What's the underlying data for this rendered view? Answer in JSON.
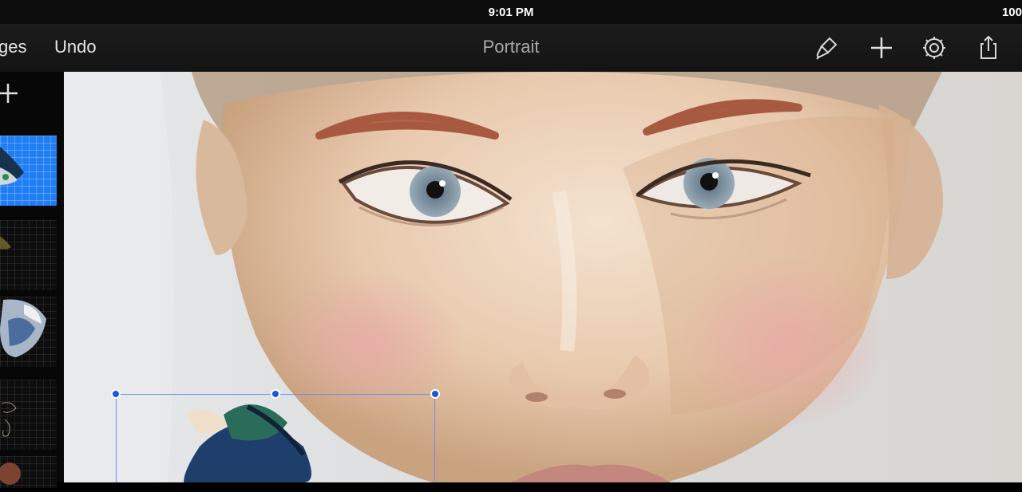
{
  "status": {
    "time": "9:01 PM",
    "battery": "100",
    "lead": ""
  },
  "toolbar": {
    "gallery_label": "ges",
    "undo_label": "Undo",
    "title": "Portrait",
    "icons": [
      "brush-icon",
      "plus-icon",
      "gear-icon",
      "share-icon"
    ]
  },
  "sidebar": {
    "add_icon": "plus-icon",
    "layers": [
      {
        "name": "bird-layer",
        "active": true
      },
      {
        "name": "leaf-layer",
        "active": false
      },
      {
        "name": "blue-shape-layer",
        "active": false
      },
      {
        "name": "sketch-layer",
        "active": false
      },
      {
        "name": "partial-layer",
        "active": false
      }
    ]
  },
  "colors": {
    "accent": "#1f7ef5",
    "handle": "#1a57e0",
    "toolbar_bg": "#1a1a1a"
  },
  "canvas": {
    "subject": "painted portrait"
  }
}
